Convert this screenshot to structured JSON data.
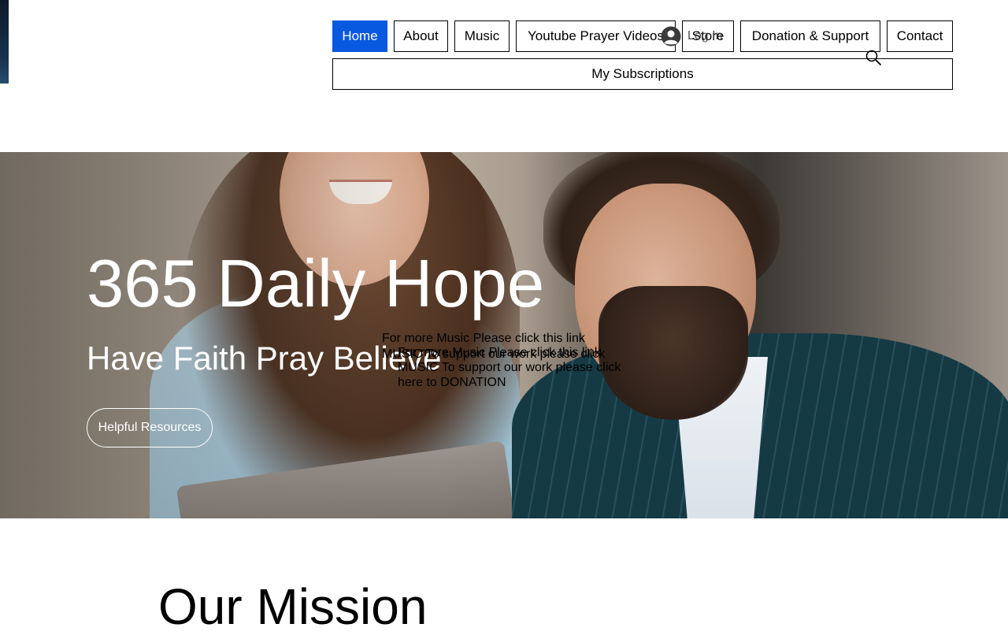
{
  "nav": {
    "home": "Home",
    "about": "About",
    "music": "Music",
    "youtube": "Youtube Prayer Videos",
    "store": "Store",
    "donation": "Donation & Support",
    "contact": "Contact",
    "subscriptions": "My Subscriptions",
    "active_color": "#0958e0"
  },
  "login": {
    "label": "Log In",
    "icon": "account-circle-icon"
  },
  "search": {
    "icon": "search-icon"
  },
  "hero": {
    "title": "365 Daily Hope",
    "subtitle": "Have Faith Pray Believe",
    "button": "Helpful Resources"
  },
  "overlay_text": {
    "block_a_line1": "For more Music Please click this link",
    "block_a_line2": "MUSIC To support our work please click",
    "block_b_line1": "For more Music Please click this link",
    "block_b_line2": "MUSIC To support our work please click",
    "block_b_line3": "here to  DONATION"
  },
  "mission": {
    "title": "Our Mission"
  }
}
